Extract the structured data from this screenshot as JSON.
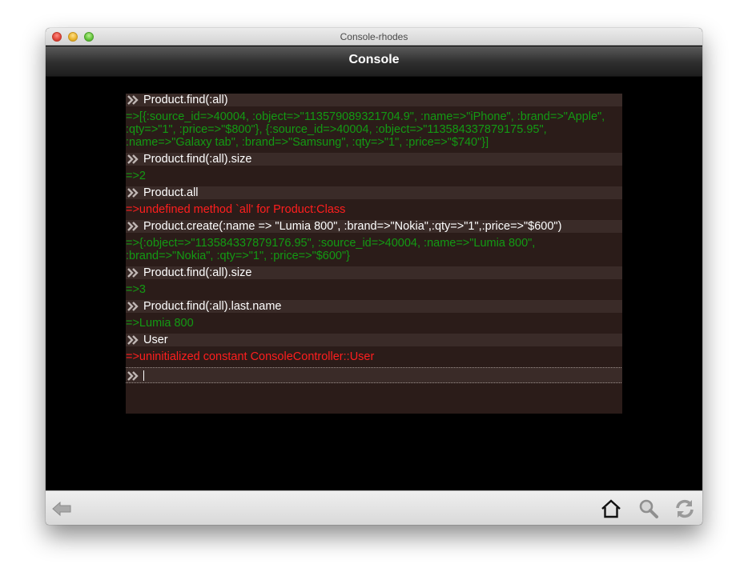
{
  "window": {
    "title": "Console-rhodes"
  },
  "header": {
    "title": "Console"
  },
  "console": {
    "entries": [
      {
        "command": "Product.find(:all)",
        "result": "=>[{:source_id=>40004, :object=>\"113579089321704.9\", :name=>\"iPhone\", :brand=>\"Apple\", :qty=>\"1\", :price=>\"$800\"}, {:source_id=>40004, :object=>\"113584337879175.95\", :name=>\"Galaxy tab\", :brand=>\"Samsung\", :qty=>\"1\", :price=>\"$740\"}]"
      },
      {
        "command": "Product.find(:all).size",
        "result": "=>2"
      },
      {
        "command": "Product.all",
        "result": "=>undefined method `all' for Product:Class"
      },
      {
        "command": "Product.create(:name => \"Lumia 800\", :brand=>\"Nokia\",:qty=>\"1\",:price=>\"$600\")",
        "result": "=>{:object=>\"113584337879176.95\", :source_id=>40004, :name=>\"Lumia 800\", :brand=>\"Nokia\", :qty=>\"1\", :price=>\"$600\"}"
      },
      {
        "command": "Product.find(:all).size",
        "result": "=>3"
      },
      {
        "command": "Product.find(:all).last.name",
        "result": "=>Lumia 800"
      },
      {
        "command": "User",
        "result": "=>uninitialized constant ConsoleController::User"
      }
    ]
  },
  "colors": {
    "result_ok": "#139a13",
    "result_error": "#ff1e1e",
    "console_bg": "#2b1c19",
    "command_bg": "#3a2b28"
  },
  "icons": {
    "prompt": "double-chevron-right-icon",
    "back": "arrow-left-icon",
    "home": "home-icon",
    "search": "magnifier-icon",
    "refresh": "refresh-icon"
  }
}
